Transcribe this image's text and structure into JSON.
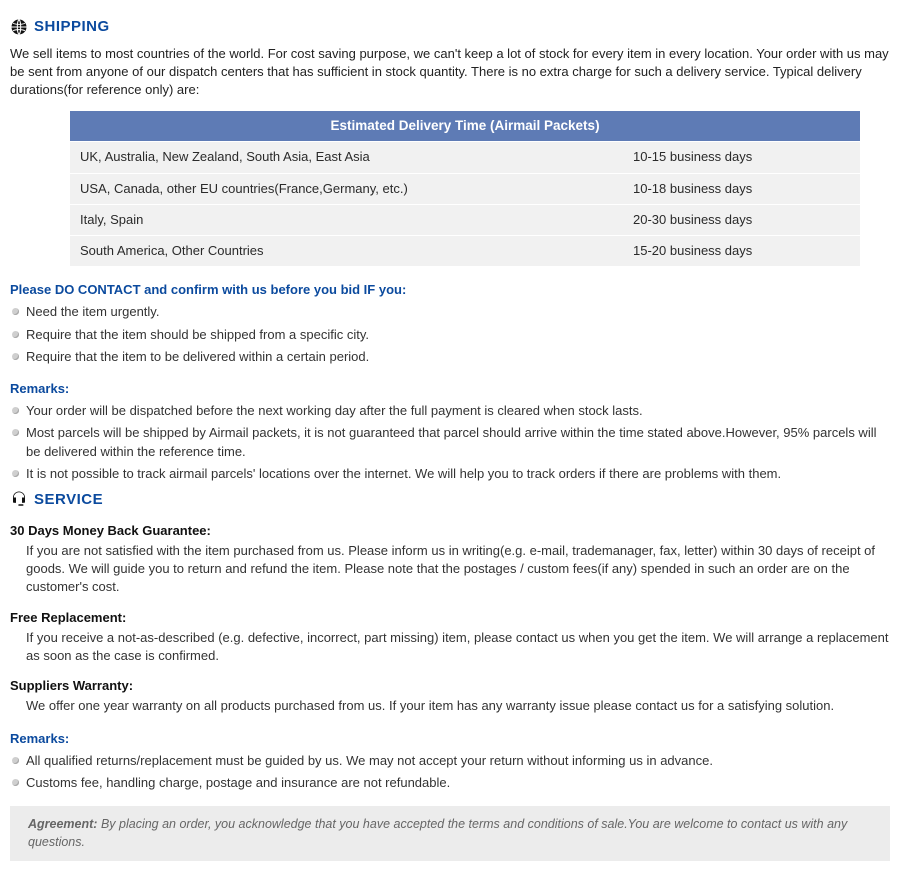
{
  "shipping": {
    "title": "SHIPPING",
    "intro": "We sell items to most countries of the world. For cost saving purpose, we can't keep a lot of stock for every item in every location. Your order with us may be sent from anyone of our dispatch centers that has sufficient in stock quantity. There is no extra charge for such a delivery service. Typical delivery durations(for reference only) are:",
    "table_header": "Estimated Delivery Time (Airmail Packets)",
    "rows": [
      {
        "region": "UK, Australia, New Zealand, South Asia, East Asia",
        "time": "10-15 business days"
      },
      {
        "region": "USA, Canada, other EU countries(France,Germany, etc.)",
        "time": "10-18 business days"
      },
      {
        "region": "Italy, Spain",
        "time": "20-30 business days"
      },
      {
        "region": "South America, Other Countries",
        "time": "15-20 business days"
      }
    ],
    "contact_heading": "Please DO CONTACT and confirm with us before you bid IF you:",
    "contact_items": [
      "Need the item urgently.",
      "Require that the item should be shipped from a specific city.",
      "Require that the item to be delivered within a certain period."
    ],
    "remarks_heading": "Remarks:",
    "remarks_items": [
      "Your order will be dispatched before the next working day after the full payment is cleared when stock lasts.",
      "Most parcels will be shipped by Airmail packets, it is not guaranteed that parcel should arrive within the time stated above.However, 95% parcels will be delivered within the reference time.",
      "It is not possible to track airmail parcels' locations over the internet. We will help you to track orders if there are problems with them."
    ]
  },
  "service": {
    "title": "SERVICE",
    "guarantee_heading": "30 Days Money Back Guarantee:",
    "guarantee_text": "If you are not satisfied with the item purchased from us. Please inform us in writing(e.g. e-mail, trademanager, fax, letter) within 30 days of receipt of goods. We will guide you to return and refund the item. Please note that the postages / custom fees(if any) spended in such an order are on the customer's cost.",
    "replacement_heading": "Free Replacement:",
    "replacement_text": "If you receive a not-as-described (e.g. defective, incorrect, part missing) item, please contact us when you get the item. We will arrange a replacement as soon as the case is confirmed.",
    "warranty_heading": "Suppliers Warranty:",
    "warranty_text": "We offer one year warranty on all products purchased from us. If your item has any warranty issue please contact us for a satisfying solution.",
    "remarks_heading": "Remarks:",
    "remarks_items": [
      "All qualified returns/replacement must be guided by us. We may not accept your return without informing us in advance.",
      "Customs fee, handling charge, postage and insurance are not refundable."
    ]
  },
  "agreement": {
    "label": "Agreement:",
    "text": "By placing an order, you acknowledge that you have accepted the terms and conditions of sale.You are welcome to contact us with any questions."
  }
}
